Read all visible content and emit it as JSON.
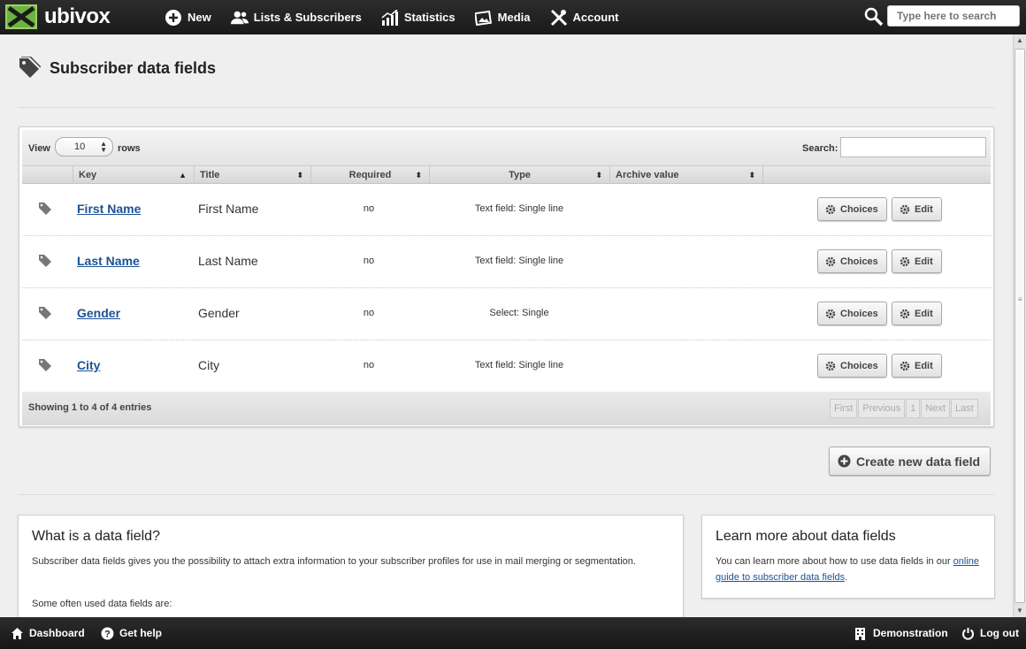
{
  "app": {
    "name": "ubivox"
  },
  "nav": [
    {
      "label": "New",
      "icon": "plus-circle-icon"
    },
    {
      "label": "Lists & Subscribers",
      "icon": "users-icon"
    },
    {
      "label": "Statistics",
      "icon": "bar-chart-icon"
    },
    {
      "label": "Media",
      "icon": "images-icon"
    },
    {
      "label": "Account",
      "icon": "tools-icon"
    }
  ],
  "search": {
    "placeholder": "Type here to search"
  },
  "page": {
    "title": "Subscriber data fields"
  },
  "table": {
    "view_label": "View",
    "rows_value": "10",
    "rows_label": "rows",
    "search_label": "Search:",
    "columns": [
      "Key",
      "Title",
      "Required",
      "Type",
      "Archive value"
    ],
    "rows": [
      {
        "key": "First Name",
        "title": "First Name",
        "required": "no",
        "type": "Text field: Single line",
        "archive": ""
      },
      {
        "key": "Last Name",
        "title": "Last Name",
        "required": "no",
        "type": "Text field: Single line",
        "archive": ""
      },
      {
        "key": "Gender",
        "title": "Gender",
        "required": "no",
        "type": "Select: Single",
        "archive": ""
      },
      {
        "key": "City",
        "title": "City",
        "required": "no",
        "type": "Text field: Single line",
        "archive": ""
      }
    ],
    "choices_label": "Choices",
    "edit_label": "Edit",
    "info": "Showing 1 to 4 of 4 entries",
    "pager": [
      "First",
      "Previous",
      "1",
      "Next",
      "Last"
    ]
  },
  "create_button": "Create new data field",
  "box_what": {
    "title": "What is a data field?",
    "text1": "Subscriber data fields gives you the possibility to attach extra information to your subscriber profiles for use in mail merging or segmentation.",
    "text2": "Some often used data fields are:"
  },
  "box_learn": {
    "title": "Learn more about data fields",
    "text": "You can learn more about how to use data fields in our ",
    "link": "online guide to subscriber data fields",
    "text_end": "."
  },
  "footer": {
    "dashboard": "Dashboard",
    "help": "Get help",
    "demonstration": "Demonstration",
    "logout": "Log out"
  },
  "colors": {
    "brand_green": "#6db33f",
    "link_blue": "#1d5296",
    "topbar": "#1f1f1f"
  }
}
